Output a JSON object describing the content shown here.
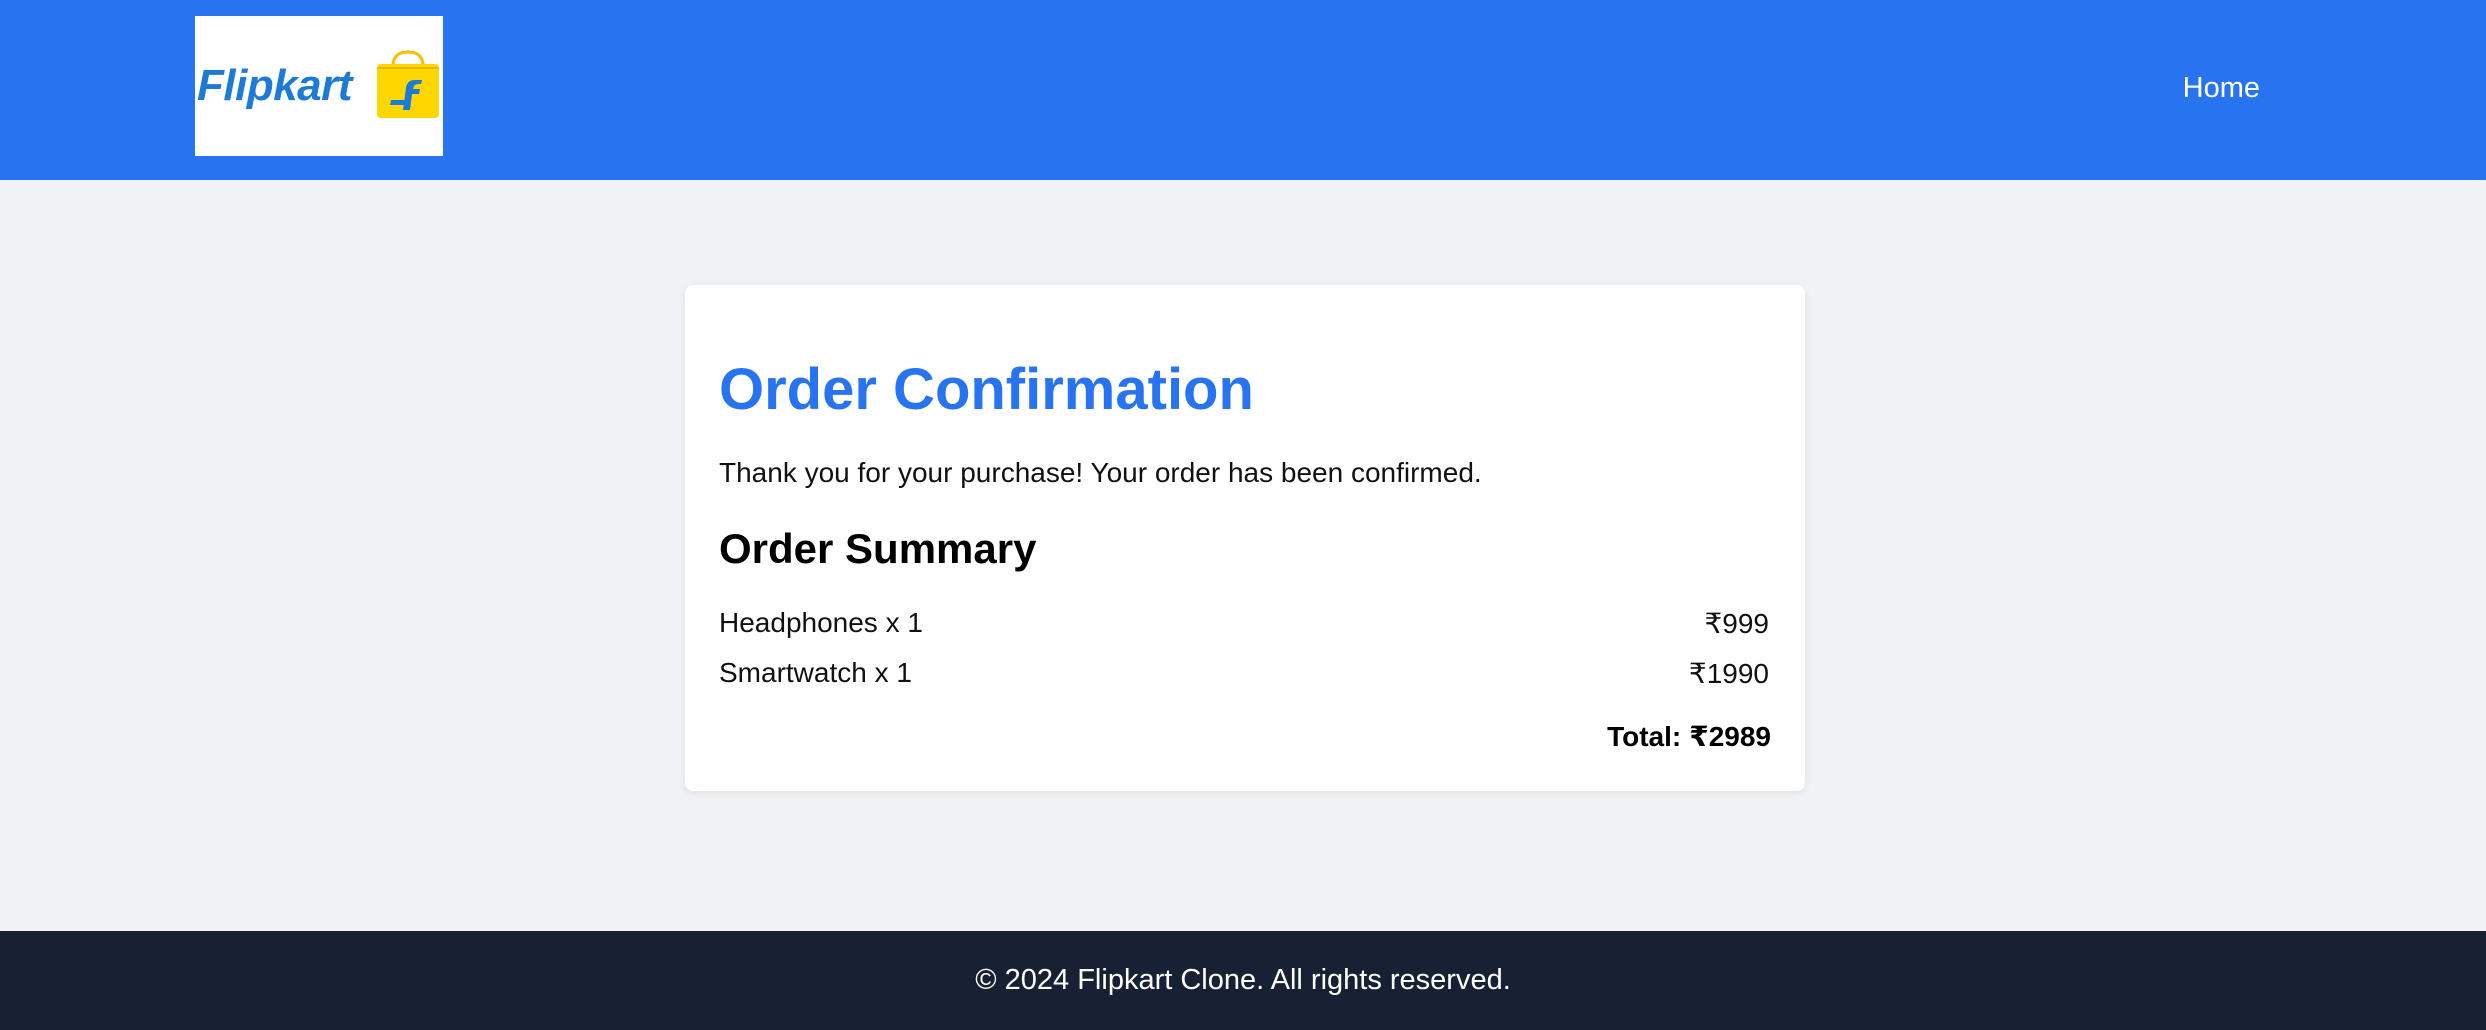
{
  "header": {
    "logo_text": "Flipkart",
    "nav_home_label": "Home"
  },
  "order": {
    "title": "Order Confirmation",
    "message": "Thank you for your purchase! Your order has been confirmed.",
    "summary_title": "Order Summary",
    "items": [
      {
        "name": "Headphones x 1",
        "price": "₹999"
      },
      {
        "name": "Smartwatch x 1",
        "price": "₹1990"
      }
    ],
    "total_label": "Total:",
    "total_value": "₹2989"
  },
  "footer": {
    "text": "© 2024 Flipkart Clone. All rights reserved."
  },
  "colors": {
    "header_bg": "#2874f0",
    "footer_bg": "#172133",
    "title_accent": "#2874f0",
    "logo_yellow": "#ffd700",
    "logo_blue": "#1d7bd6"
  }
}
